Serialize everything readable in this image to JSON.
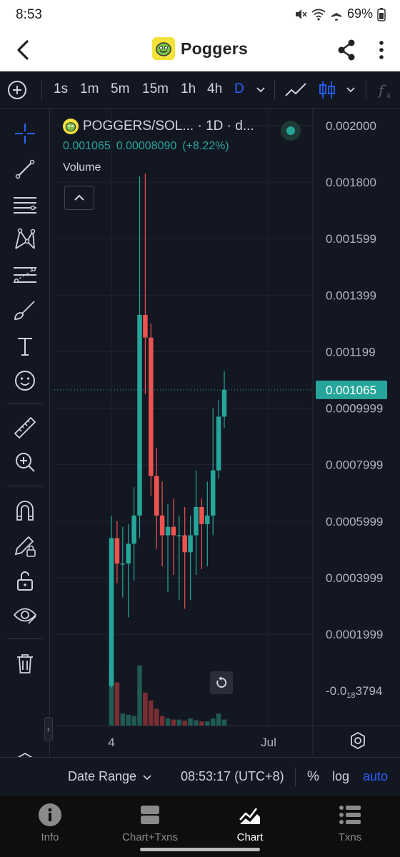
{
  "status": {
    "time": "8:53",
    "battery": "69%"
  },
  "header": {
    "title": "Poggers"
  },
  "toolbar": {
    "intervals": [
      "1s",
      "1m",
      "5m",
      "15m",
      "1h",
      "4h",
      "D"
    ],
    "active_interval": "D"
  },
  "legend": {
    "symbol": "POGGERS/SOL... · 1D · d...",
    "close": "0.001065",
    "change": "0.00008090",
    "change_pct": "(+8.22%)",
    "volume_label": "Volume"
  },
  "price_axis": {
    "ticks": [
      "0.002000",
      "0.001800",
      "0.001599",
      "0.001399",
      "0.001199",
      "0.0009999",
      "0.0007999",
      "0.0005999",
      "0.0003999",
      "0.0001999"
    ],
    "negative_tick_prefix": "-0.0",
    "negative_tick_sub": "18",
    "negative_tick_suffix": "3794",
    "current_price": "0.001065"
  },
  "time_axis": {
    "labels": [
      "4",
      "Jul"
    ]
  },
  "range_bar": {
    "date_range": "Date Range",
    "clock": "08:53:17 (UTC+8)",
    "percent": "%",
    "log": "log",
    "auto": "auto"
  },
  "nav": [
    {
      "label": "Info",
      "icon": "info-icon"
    },
    {
      "label": "Chart+Txns",
      "icon": "chart-txns-icon"
    },
    {
      "label": "Chart",
      "icon": "chart-icon",
      "active": true
    },
    {
      "label": "Txns",
      "icon": "list-icon"
    }
  ],
  "colors": {
    "up": "#26a69a",
    "down": "#ef5350",
    "bg": "#131722",
    "accent": "#2962ff"
  },
  "chart_data": {
    "type": "candlestick",
    "y_min": -2e-05,
    "y_max": 0.002,
    "candles": [
      {
        "o": 1.7e-05,
        "h": 0.00062,
        "l": 1e-05,
        "c": 0.00054
      },
      {
        "o": 0.00054,
        "h": 0.0006,
        "l": 0.00038,
        "c": 0.00045
      },
      {
        "o": 0.00045,
        "h": 0.00058,
        "l": 0.00033,
        "c": 0.00045
      },
      {
        "o": 0.00045,
        "h": 0.00059,
        "l": 0.00026,
        "c": 0.00052
      },
      {
        "o": 0.00052,
        "h": 0.00072,
        "l": 0.00039,
        "c": 0.00062
      },
      {
        "o": 0.00062,
        "h": 0.00182,
        "l": 0.00054,
        "c": 0.00133
      },
      {
        "o": 0.00133,
        "h": 0.00183,
        "l": 0.00105,
        "c": 0.00125
      },
      {
        "o": 0.00125,
        "h": 0.0013,
        "l": 0.00069,
        "c": 0.00076
      },
      {
        "o": 0.00076,
        "h": 0.00086,
        "l": 0.0005,
        "c": 0.00062
      },
      {
        "o": 0.00062,
        "h": 0.00074,
        "l": 0.00044,
        "c": 0.00055
      },
      {
        "o": 0.00055,
        "h": 0.00066,
        "l": 0.00035,
        "c": 0.00058
      },
      {
        "o": 0.00058,
        "h": 0.00068,
        "l": 0.00041,
        "c": 0.00055
      },
      {
        "o": 0.00055,
        "h": 0.00062,
        "l": 0.00032,
        "c": 0.00055
      },
      {
        "o": 0.00055,
        "h": 0.00065,
        "l": 0.00029,
        "c": 0.00049
      },
      {
        "o": 0.00049,
        "h": 0.00062,
        "l": 0.00032,
        "c": 0.00055
      },
      {
        "o": 0.00055,
        "h": 0.00078,
        "l": 0.00041,
        "c": 0.00065
      },
      {
        "o": 0.00065,
        "h": 0.00068,
        "l": 0.00043,
        "c": 0.00059
      },
      {
        "o": 0.00059,
        "h": 0.00074,
        "l": 0.00044,
        "c": 0.00062
      },
      {
        "o": 0.00062,
        "h": 0.001,
        "l": 0.00055,
        "c": 0.00078
      },
      {
        "o": 0.00078,
        "h": 0.00103,
        "l": 0.00075,
        "c": 0.00097
      },
      {
        "o": 0.00097,
        "h": 0.00113,
        "l": 0.00093,
        "c": 0.001065
      }
    ],
    "volume_rel": [
      0.95,
      0.72,
      0.2,
      0.18,
      0.16,
      1.0,
      0.55,
      0.42,
      0.28,
      0.16,
      0.12,
      0.1,
      0.1,
      0.08,
      0.12,
      0.09,
      0.07,
      0.07,
      0.12,
      0.2,
      0.1
    ]
  }
}
